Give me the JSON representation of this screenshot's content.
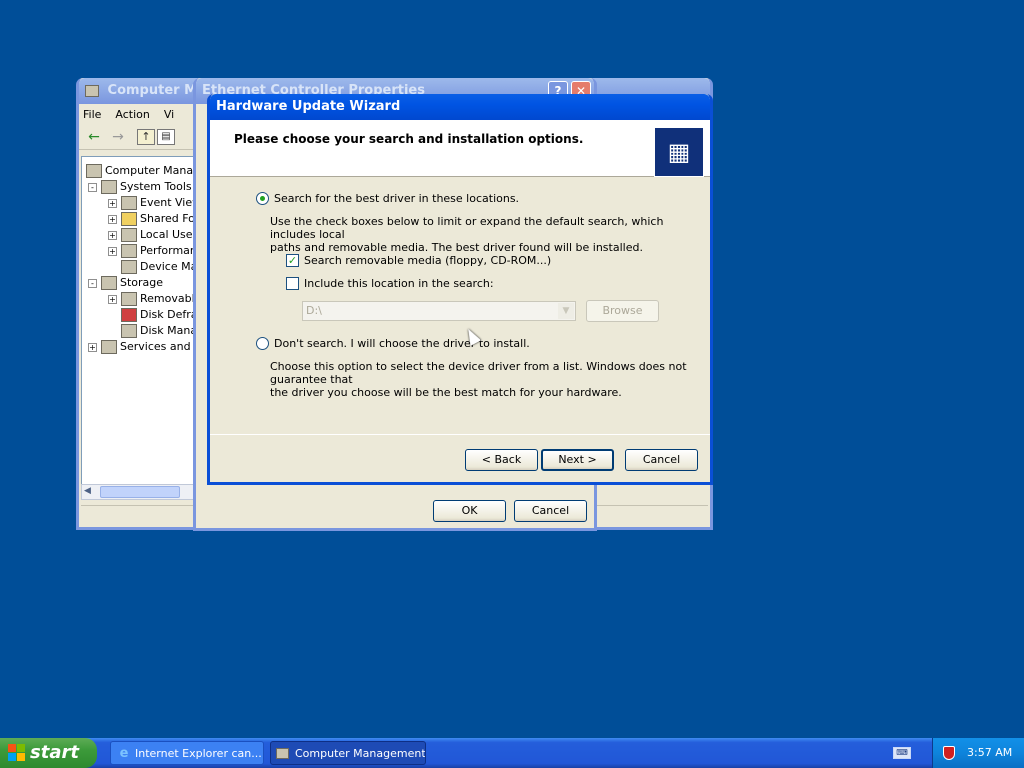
{
  "colors": {
    "desktop": "#004e98",
    "titlebar_active": "#0054e3",
    "radio_dot": "#21a121"
  },
  "computer_management": {
    "title": "Computer Mana",
    "menu": [
      "File",
      "Action",
      "Vi"
    ],
    "tree": [
      {
        "label": "Computer Manage",
        "icon": "computer-icon"
      },
      {
        "label": "System Tools",
        "icon": "tools-icon"
      },
      {
        "label": "Event Viewe",
        "icon": "event-viewer-icon"
      },
      {
        "label": "Shared Fo",
        "icon": "shared-folders-icon"
      },
      {
        "label": "Local User",
        "icon": "users-icon"
      },
      {
        "label": "Performan",
        "icon": "performance-icon"
      },
      {
        "label": "Device Ma",
        "icon": "device-manager-icon"
      },
      {
        "label": "Storage",
        "icon": "storage-icon"
      },
      {
        "label": "Removable",
        "icon": "removable-storage-icon"
      },
      {
        "label": "Disk Defra",
        "icon": "defrag-icon"
      },
      {
        "label": "Disk Manag",
        "icon": "disk-management-icon"
      },
      {
        "label": "Services and A",
        "icon": "services-icon"
      }
    ]
  },
  "properties": {
    "title": "Ethernet Controller Properties",
    "ok_label": "OK",
    "cancel_label": "Cancel"
  },
  "wizard": {
    "title": "Hardware Update Wizard",
    "header": "Please choose your search and installation options.",
    "option1": {
      "label": "Search for the best driver in these locations.",
      "selected": true,
      "desc_line1": "Use the check boxes below to limit or expand the default search, which includes local",
      "desc_line2": "paths and removable media. The best driver found will be installed."
    },
    "check_removable": {
      "label": "Search removable media (floppy, CD-ROM...)",
      "checked": true
    },
    "check_location": {
      "label": "Include this location in the search:",
      "checked": false
    },
    "location_value": "D:\\",
    "browse_label": "Browse",
    "option2": {
      "label": "Don't search. I will choose the driver to install.",
      "selected": false,
      "desc_line1": "Choose this option to select the device driver from a list.  Windows does not guarantee that",
      "desc_line2": "the driver you choose will be the best match for your hardware."
    },
    "back_label": "< Back",
    "next_label": "Next >",
    "cancel_label": "Cancel"
  },
  "taskbar": {
    "start_label": "start",
    "tasks": [
      {
        "label": "Internet Explorer can...",
        "icon": "internet-explorer-icon"
      },
      {
        "label": "Computer Management",
        "icon": "computer-management-icon"
      }
    ],
    "clock": "3:57 AM"
  }
}
